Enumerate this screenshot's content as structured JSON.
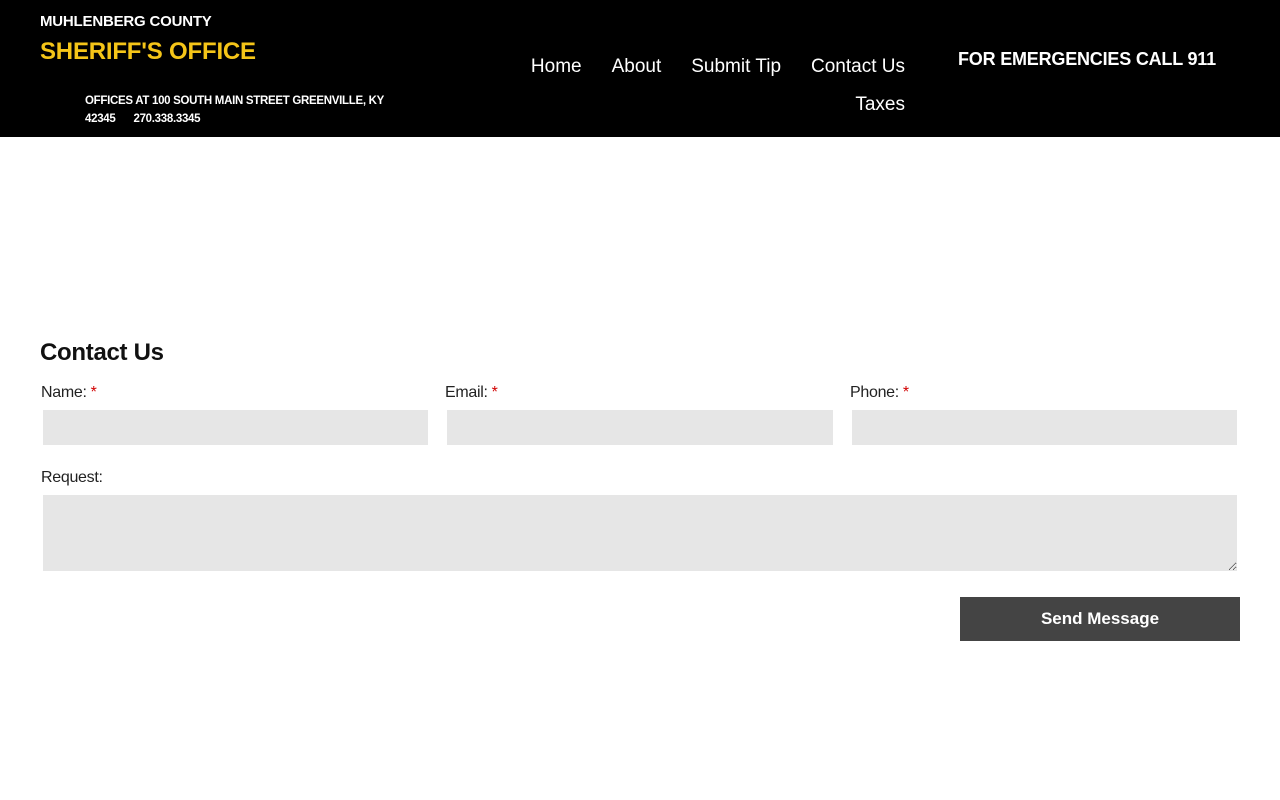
{
  "header": {
    "county": "MUHLENBERG COUNTY",
    "office": "SHERIFF'S OFFICE",
    "address": "OFFICES AT 100 SOUTH MAIN STREET GREENVILLE, KY 42345",
    "phone": "270.338.3345",
    "emergency": "FOR EMERGENCIES CALL 911",
    "brand_color": "#f5c518"
  },
  "nav": {
    "items": [
      {
        "label": "Home"
      },
      {
        "label": "About"
      },
      {
        "label": "Submit Tip"
      },
      {
        "label": "Contact Us"
      },
      {
        "label": "Taxes"
      }
    ]
  },
  "form": {
    "title": "Contact Us",
    "name_label": "Name:",
    "email_label": "Email:",
    "phone_label": "Phone:",
    "request_label": "Request:",
    "required_mark": "*",
    "name_value": "",
    "email_value": "",
    "phone_value": "",
    "request_value": "",
    "send_label": "Send Message"
  }
}
